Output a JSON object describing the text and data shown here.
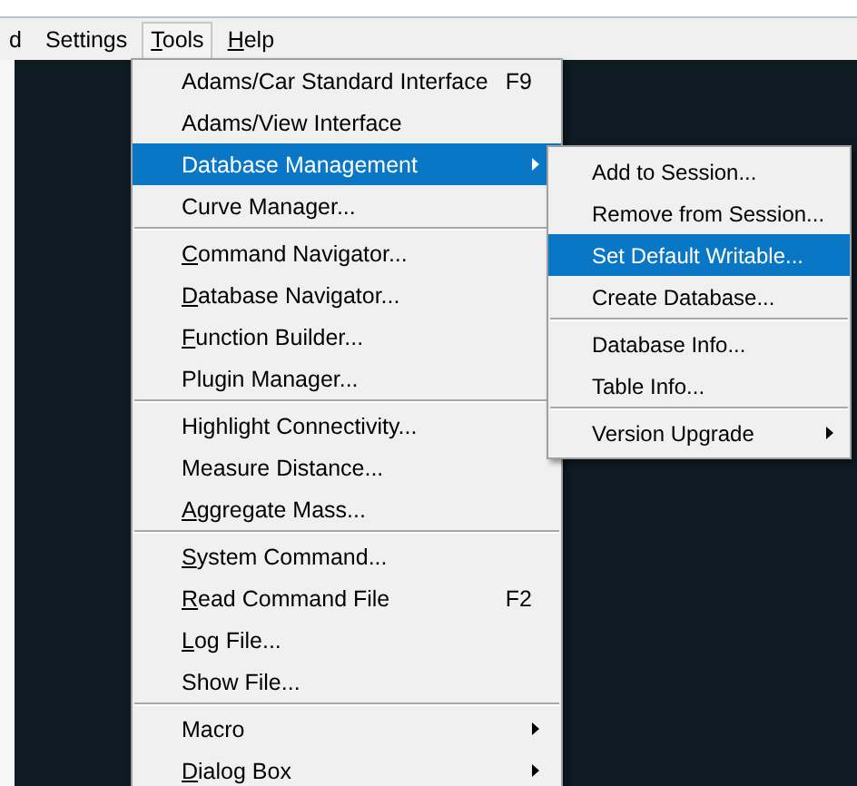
{
  "menubar": [
    {
      "label": "d",
      "selected": false,
      "mnemonic_first": false
    },
    {
      "label": "Settings",
      "selected": false,
      "mnemonic_first": false
    },
    {
      "label": "Tools",
      "selected": true,
      "mnemonic_first": true
    },
    {
      "label": "Help",
      "selected": false,
      "mnemonic_first": true
    }
  ],
  "tools_menu": [
    {
      "kind": "item",
      "label": "Adams/Car Standard Interface",
      "shortcut": "F9",
      "selected": false,
      "submenu": false,
      "mnemonic_first": false
    },
    {
      "kind": "item",
      "label": "Adams/View Interface",
      "selected": false,
      "submenu": false,
      "mnemonic_first": false
    },
    {
      "kind": "item",
      "label": "Database Management",
      "selected": true,
      "submenu": true,
      "mnemonic_first": false
    },
    {
      "kind": "item",
      "label": "Curve Manager...",
      "selected": false,
      "submenu": false,
      "mnemonic_first": false
    },
    {
      "kind": "separator"
    },
    {
      "kind": "item",
      "label": "Command Navigator...",
      "selected": false,
      "submenu": false,
      "mnemonic_first": true
    },
    {
      "kind": "item",
      "label": "Database Navigator...",
      "selected": false,
      "submenu": false,
      "mnemonic_first": true
    },
    {
      "kind": "item",
      "label": "Function Builder...",
      "selected": false,
      "submenu": false,
      "mnemonic_first": true
    },
    {
      "kind": "item",
      "label": "Plugin Manager...",
      "selected": false,
      "submenu": false,
      "mnemonic_first": false
    },
    {
      "kind": "separator"
    },
    {
      "kind": "item",
      "label": "Highlight Connectivity...",
      "selected": false,
      "submenu": false,
      "mnemonic_first": false
    },
    {
      "kind": "item",
      "label": "Measure Distance...",
      "selected": false,
      "submenu": false,
      "mnemonic_first": false
    },
    {
      "kind": "item",
      "label": "Aggregate Mass...",
      "selected": false,
      "submenu": false,
      "mnemonic_first": true
    },
    {
      "kind": "separator"
    },
    {
      "kind": "item",
      "label": "System Command...",
      "selected": false,
      "submenu": false,
      "mnemonic_first": true
    },
    {
      "kind": "item",
      "label": "Read Command File",
      "shortcut": "F2",
      "selected": false,
      "submenu": false,
      "mnemonic_first": true
    },
    {
      "kind": "item",
      "label": "Log File...",
      "selected": false,
      "submenu": false,
      "mnemonic_first": true
    },
    {
      "kind": "item",
      "label": "Show File...",
      "selected": false,
      "submenu": false,
      "mnemonic_first": false
    },
    {
      "kind": "separator"
    },
    {
      "kind": "item",
      "label": "Macro",
      "selected": false,
      "submenu": true,
      "mnemonic_first": false
    },
    {
      "kind": "item",
      "label": "Dialog Box",
      "selected": false,
      "submenu": true,
      "mnemonic_first": true
    }
  ],
  "database_submenu": [
    {
      "kind": "item",
      "label": "Add to Session...",
      "selected": false,
      "submenu": false,
      "mnemonic_first": false
    },
    {
      "kind": "item",
      "label": "Remove from Session...",
      "selected": false,
      "submenu": false,
      "mnemonic_first": false
    },
    {
      "kind": "item",
      "label": "Set Default Writable...",
      "selected": true,
      "submenu": false,
      "mnemonic_first": false
    },
    {
      "kind": "item",
      "label": "Create Database...",
      "selected": false,
      "submenu": false,
      "mnemonic_first": false
    },
    {
      "kind": "separator"
    },
    {
      "kind": "item",
      "label": "Database Info...",
      "selected": false,
      "submenu": false,
      "mnemonic_first": false
    },
    {
      "kind": "item",
      "label": "Table Info...",
      "selected": false,
      "submenu": false,
      "mnemonic_first": false
    },
    {
      "kind": "separator"
    },
    {
      "kind": "item",
      "label": "Version Upgrade",
      "selected": false,
      "submenu": true,
      "mnemonic_first": false
    }
  ]
}
